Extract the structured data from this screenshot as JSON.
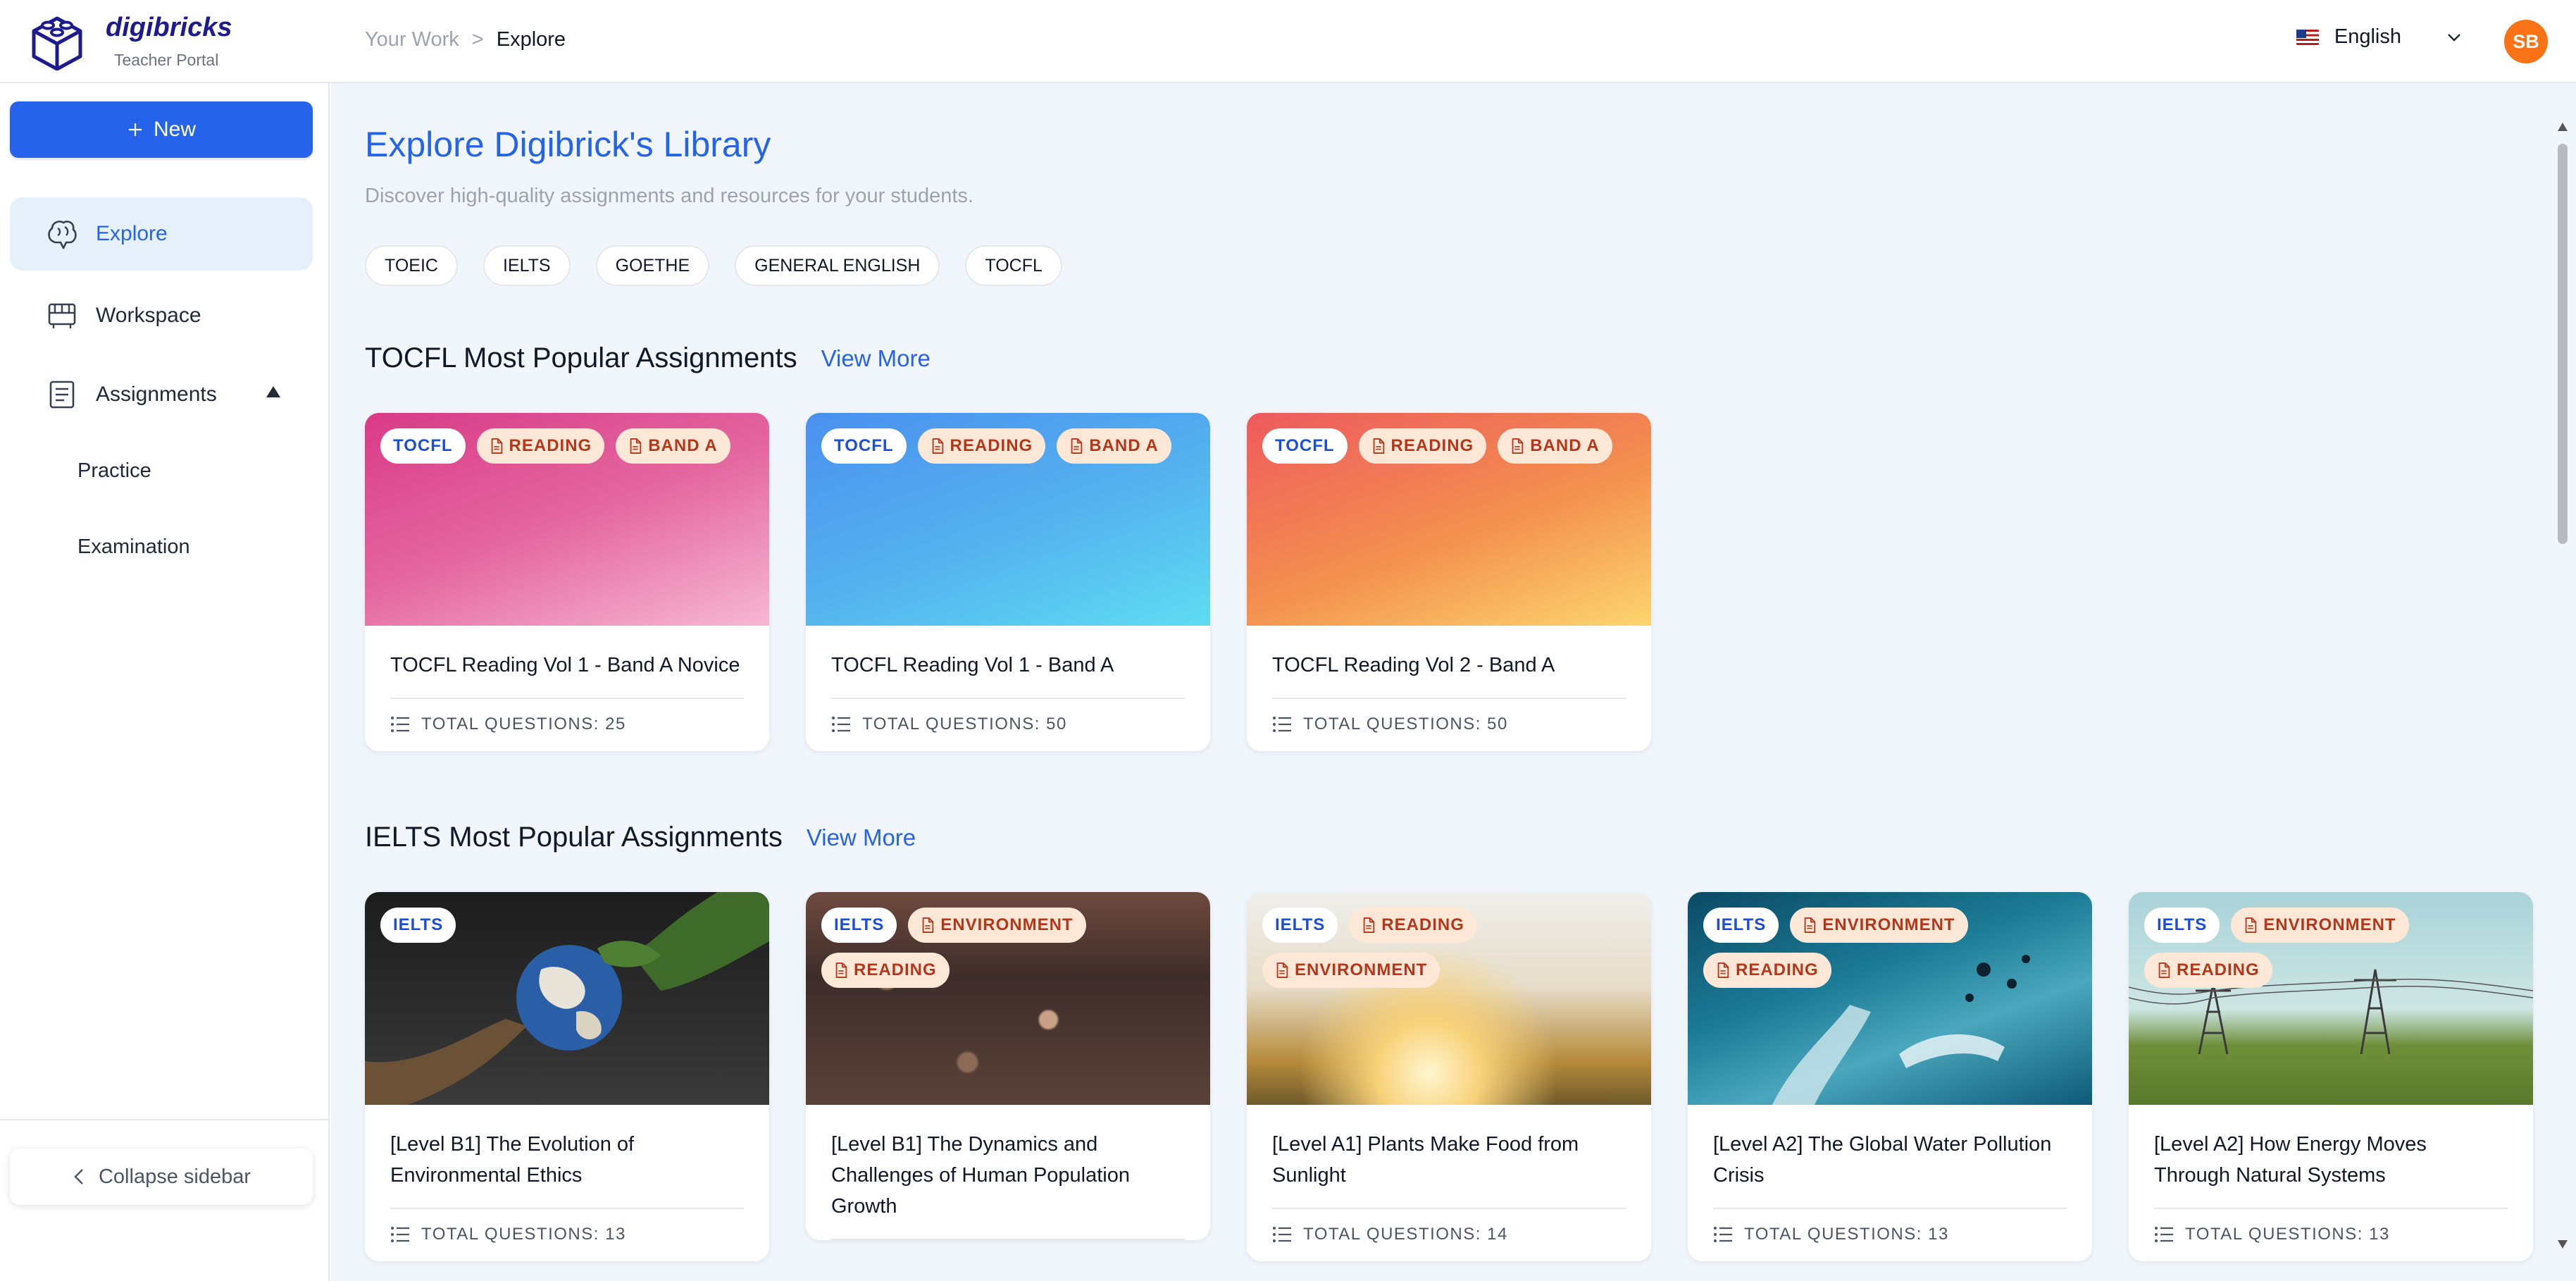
{
  "header": {
    "brand": "digibricks",
    "brand_sub": "Teacher Portal",
    "breadcrumb": [
      "Your Work",
      ">",
      "Explore"
    ],
    "language": "English",
    "avatar_initials": "SB",
    "avatar_color": "#f97316"
  },
  "sidebar": {
    "new_label": "New",
    "items": [
      {
        "label": "Explore",
        "icon": "brain-icon",
        "active": true
      },
      {
        "label": "Workspace",
        "icon": "workspace-icon"
      },
      {
        "label": "Assignments",
        "icon": "document-icon",
        "expanded": true
      }
    ],
    "sub_items": [
      "Practice",
      "Examination"
    ],
    "collapse_label": "Collapse sidebar"
  },
  "main": {
    "title": "Explore Digibrick's Library",
    "subtitle": "Discover high-quality assignments and resources for your students.",
    "filters": [
      "TOEIC",
      "IELTS",
      "GOETHE",
      "GENERAL ENGLISH",
      "TOCFL"
    ],
    "sections": [
      {
        "title": "TOCFL Most Popular Assignments",
        "view_more": "View More",
        "cards": [
          {
            "tags": [
              "TOCFL",
              "READING",
              "BAND A"
            ],
            "title": "TOCFL Reading Vol 1 - Band A Novice",
            "meta": "TOTAL QUESTIONS: 25"
          },
          {
            "tags": [
              "TOCFL",
              "READING",
              "BAND A"
            ],
            "title": "TOCFL Reading Vol 1 - Band A",
            "meta": "TOTAL QUESTIONS: 50"
          },
          {
            "tags": [
              "TOCFL",
              "READING",
              "BAND A"
            ],
            "title": "TOCFL Reading Vol 2 - Band A",
            "meta": "TOTAL QUESTIONS: 50"
          }
        ]
      },
      {
        "title": "IELTS Most Popular Assignments",
        "view_more": "View More",
        "cards": [
          {
            "tags": [
              "IELTS"
            ],
            "title": "[Level B1] The Evolution of Environmental Ethics",
            "meta": "TOTAL QUESTIONS: 13"
          },
          {
            "tags": [
              "IELTS",
              "ENVIRONMENT",
              "READING"
            ],
            "title": "[Level B1] The Dynamics and Challenges of Human Population Growth",
            "meta": ""
          },
          {
            "tags": [
              "IELTS",
              "READING",
              "ENVIRONMENT"
            ],
            "title": "[Level A1] Plants Make Food from Sunlight",
            "meta": "TOTAL QUESTIONS: 14"
          },
          {
            "tags": [
              "IELTS",
              "ENVIRONMENT",
              "READING"
            ],
            "title": "[Level A2] The Global Water Pollution Crisis",
            "meta": "TOTAL QUESTIONS: 13"
          },
          {
            "tags": [
              "IELTS",
              "ENVIRONMENT",
              "READING"
            ],
            "title": "[Level A2] How Energy Moves Through Natural Systems",
            "meta": "TOTAL QUESTIONS: 13"
          }
        ]
      }
    ]
  },
  "colors": {
    "accent": "#2563eb",
    "tag_orange_bg": "#fde8d8",
    "tag_orange_text": "#b4371a",
    "main_bg": "#f1f6fc"
  }
}
